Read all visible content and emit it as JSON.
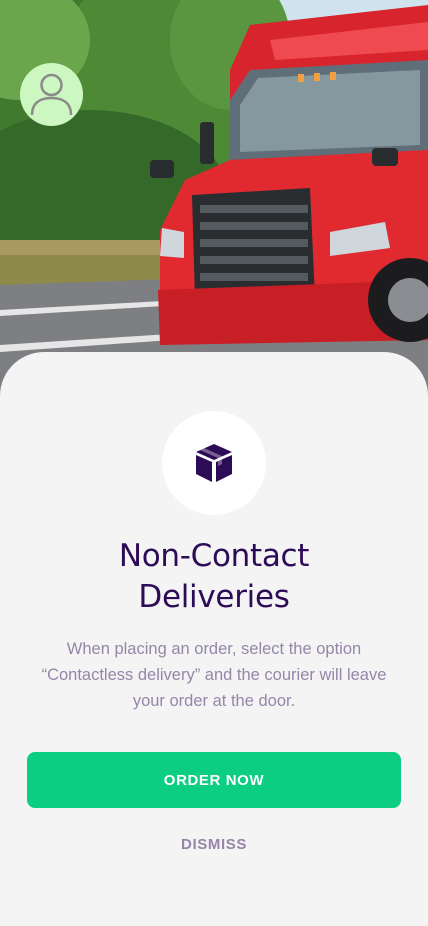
{
  "profile": {
    "avatar_icon": "user-icon"
  },
  "promo": {
    "icon": "package-box-icon",
    "title_line1": "Non-Contact",
    "title_line2": "Deliveries",
    "description_line1": "When placing an order, select the option",
    "description_line2": "“Contactless delivery” and the courier will leave",
    "description_line3": "your order at the door.",
    "primary_button": "ORDER NOW",
    "secondary_button": "DISMISS"
  },
  "colors": {
    "title": "#2d0c57",
    "body_text": "#9586a8",
    "primary": "#0bce83",
    "background": "#f4f4f5",
    "avatar_bg": "#cdf7c0"
  }
}
